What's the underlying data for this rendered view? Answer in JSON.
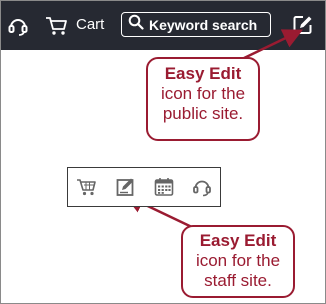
{
  "header": {
    "cart_label": "Cart",
    "search_placeholder": "Keyword search",
    "icons": [
      "headset-icon",
      "cart-icon",
      "search-icon",
      "easy-edit-icon"
    ]
  },
  "callouts": {
    "public": {
      "title": "Easy Edit",
      "line2": "icon for the",
      "line3": "public site."
    },
    "staff": {
      "title": "Easy Edit",
      "line2": "icon for the",
      "line3": "staff site."
    }
  },
  "staff_toolbar": {
    "icons": [
      "cart-icon",
      "easy-edit-icon",
      "calendar-icon",
      "headset-icon"
    ]
  },
  "colors": {
    "header_bg": "#262932",
    "callout": "#9a1b31",
    "icon_gray": "#666666"
  }
}
